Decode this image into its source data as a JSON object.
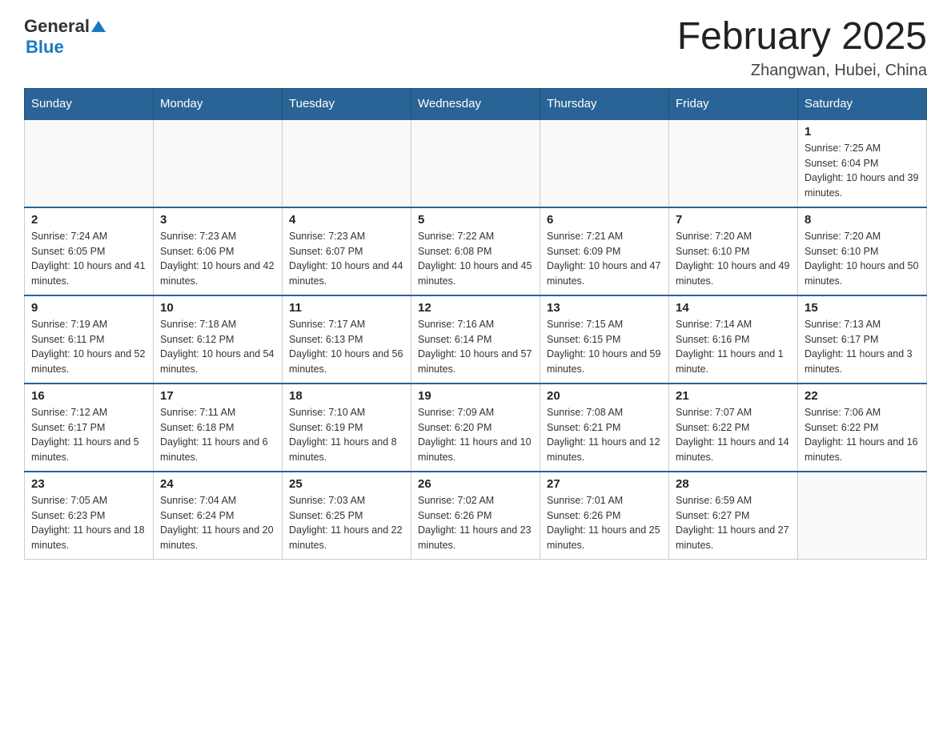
{
  "header": {
    "logo_general": "General",
    "logo_blue": "Blue",
    "title": "February 2025",
    "location": "Zhangwan, Hubei, China"
  },
  "days_of_week": [
    "Sunday",
    "Monday",
    "Tuesday",
    "Wednesday",
    "Thursday",
    "Friday",
    "Saturday"
  ],
  "weeks": [
    [
      {
        "day": "",
        "info": ""
      },
      {
        "day": "",
        "info": ""
      },
      {
        "day": "",
        "info": ""
      },
      {
        "day": "",
        "info": ""
      },
      {
        "day": "",
        "info": ""
      },
      {
        "day": "",
        "info": ""
      },
      {
        "day": "1",
        "info": "Sunrise: 7:25 AM\nSunset: 6:04 PM\nDaylight: 10 hours and 39 minutes."
      }
    ],
    [
      {
        "day": "2",
        "info": "Sunrise: 7:24 AM\nSunset: 6:05 PM\nDaylight: 10 hours and 41 minutes."
      },
      {
        "day": "3",
        "info": "Sunrise: 7:23 AM\nSunset: 6:06 PM\nDaylight: 10 hours and 42 minutes."
      },
      {
        "day": "4",
        "info": "Sunrise: 7:23 AM\nSunset: 6:07 PM\nDaylight: 10 hours and 44 minutes."
      },
      {
        "day": "5",
        "info": "Sunrise: 7:22 AM\nSunset: 6:08 PM\nDaylight: 10 hours and 45 minutes."
      },
      {
        "day": "6",
        "info": "Sunrise: 7:21 AM\nSunset: 6:09 PM\nDaylight: 10 hours and 47 minutes."
      },
      {
        "day": "7",
        "info": "Sunrise: 7:20 AM\nSunset: 6:10 PM\nDaylight: 10 hours and 49 minutes."
      },
      {
        "day": "8",
        "info": "Sunrise: 7:20 AM\nSunset: 6:10 PM\nDaylight: 10 hours and 50 minutes."
      }
    ],
    [
      {
        "day": "9",
        "info": "Sunrise: 7:19 AM\nSunset: 6:11 PM\nDaylight: 10 hours and 52 minutes."
      },
      {
        "day": "10",
        "info": "Sunrise: 7:18 AM\nSunset: 6:12 PM\nDaylight: 10 hours and 54 minutes."
      },
      {
        "day": "11",
        "info": "Sunrise: 7:17 AM\nSunset: 6:13 PM\nDaylight: 10 hours and 56 minutes."
      },
      {
        "day": "12",
        "info": "Sunrise: 7:16 AM\nSunset: 6:14 PM\nDaylight: 10 hours and 57 minutes."
      },
      {
        "day": "13",
        "info": "Sunrise: 7:15 AM\nSunset: 6:15 PM\nDaylight: 10 hours and 59 minutes."
      },
      {
        "day": "14",
        "info": "Sunrise: 7:14 AM\nSunset: 6:16 PM\nDaylight: 11 hours and 1 minute."
      },
      {
        "day": "15",
        "info": "Sunrise: 7:13 AM\nSunset: 6:17 PM\nDaylight: 11 hours and 3 minutes."
      }
    ],
    [
      {
        "day": "16",
        "info": "Sunrise: 7:12 AM\nSunset: 6:17 PM\nDaylight: 11 hours and 5 minutes."
      },
      {
        "day": "17",
        "info": "Sunrise: 7:11 AM\nSunset: 6:18 PM\nDaylight: 11 hours and 6 minutes."
      },
      {
        "day": "18",
        "info": "Sunrise: 7:10 AM\nSunset: 6:19 PM\nDaylight: 11 hours and 8 minutes."
      },
      {
        "day": "19",
        "info": "Sunrise: 7:09 AM\nSunset: 6:20 PM\nDaylight: 11 hours and 10 minutes."
      },
      {
        "day": "20",
        "info": "Sunrise: 7:08 AM\nSunset: 6:21 PM\nDaylight: 11 hours and 12 minutes."
      },
      {
        "day": "21",
        "info": "Sunrise: 7:07 AM\nSunset: 6:22 PM\nDaylight: 11 hours and 14 minutes."
      },
      {
        "day": "22",
        "info": "Sunrise: 7:06 AM\nSunset: 6:22 PM\nDaylight: 11 hours and 16 minutes."
      }
    ],
    [
      {
        "day": "23",
        "info": "Sunrise: 7:05 AM\nSunset: 6:23 PM\nDaylight: 11 hours and 18 minutes."
      },
      {
        "day": "24",
        "info": "Sunrise: 7:04 AM\nSunset: 6:24 PM\nDaylight: 11 hours and 20 minutes."
      },
      {
        "day": "25",
        "info": "Sunrise: 7:03 AM\nSunset: 6:25 PM\nDaylight: 11 hours and 22 minutes."
      },
      {
        "day": "26",
        "info": "Sunrise: 7:02 AM\nSunset: 6:26 PM\nDaylight: 11 hours and 23 minutes."
      },
      {
        "day": "27",
        "info": "Sunrise: 7:01 AM\nSunset: 6:26 PM\nDaylight: 11 hours and 25 minutes."
      },
      {
        "day": "28",
        "info": "Sunrise: 6:59 AM\nSunset: 6:27 PM\nDaylight: 11 hours and 27 minutes."
      },
      {
        "day": "",
        "info": ""
      }
    ]
  ]
}
